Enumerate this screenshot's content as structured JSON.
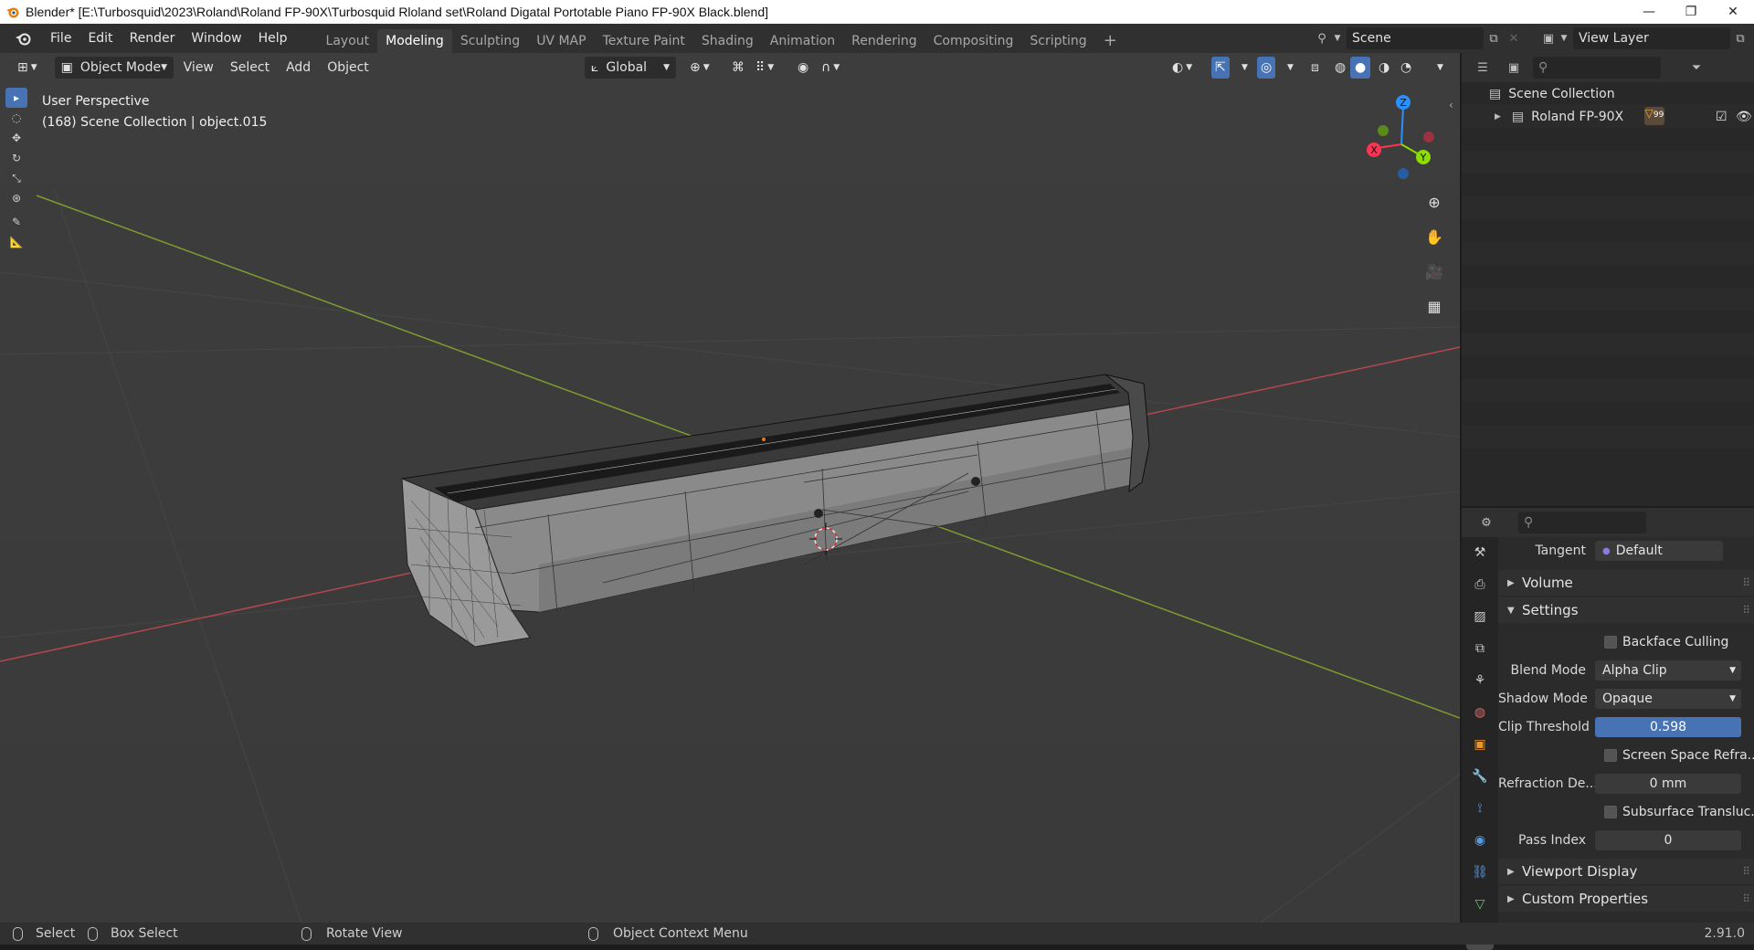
{
  "window": {
    "title": "Blender* [E:\\Turbosquid\\2023\\Roland\\Roland FP-90X\\Turbosquid Rloland set\\Roland Digatal Portotable Piano FP-90X Black.blend]",
    "minimize": "—",
    "maximize": "❐",
    "close": "✕"
  },
  "menus": [
    "File",
    "Edit",
    "Render",
    "Window",
    "Help"
  ],
  "workspaces": [
    "Layout",
    "Modeling",
    "Sculpting",
    "UV MAP",
    "Texture Paint",
    "Shading",
    "Animation",
    "Rendering",
    "Compositing",
    "Scripting"
  ],
  "active_workspace": "Modeling",
  "add_workspace": "+",
  "scene": {
    "name": "Scene",
    "view_layer": "View Layer"
  },
  "viewport": {
    "mode": "Object Mode",
    "menus": [
      "View",
      "Select",
      "Add",
      "Object"
    ],
    "transform_orientation": "Global",
    "perspective_label": "User Perspective",
    "collection_label": "(168) Scene Collection | object.015"
  },
  "gizmo": {
    "x": "X",
    "y": "Y",
    "z": "Z"
  },
  "outliner": {
    "root": "Scene Collection",
    "items": [
      {
        "label": "Roland FP-90X",
        "badge": "99"
      }
    ]
  },
  "properties": {
    "tangent_label": "Tangent",
    "tangent_value": "Default",
    "panels": {
      "volume": "Volume",
      "settings": "Settings",
      "viewport_display": "Viewport Display",
      "custom_properties": "Custom Properties"
    },
    "backface_culling": "Backface Culling",
    "blend_mode_label": "Blend Mode",
    "blend_mode_value": "Alpha Clip",
    "shadow_mode_label": "Shadow Mode",
    "shadow_mode_value": "Opaque",
    "clip_threshold_label": "Clip Threshold",
    "clip_threshold_value": "0.598",
    "screen_space_refraction": "Screen Space Refra...",
    "refraction_depth_label": "Refraction De...",
    "refraction_depth_value": "0 mm",
    "subsurface_translucency": "Subsurface Transluc...",
    "pass_index_label": "Pass Index",
    "pass_index_value": "0"
  },
  "statusbar": {
    "select": "Select",
    "box_select": "Box Select",
    "rotate_view": "Rotate View",
    "context_menu": "Object Context Menu",
    "version": "2.91.0"
  },
  "colors": {
    "accent_blue": "#4772b3",
    "axis_x": "#ff3352",
    "axis_y": "#8bdc00",
    "axis_z": "#2890ff"
  }
}
